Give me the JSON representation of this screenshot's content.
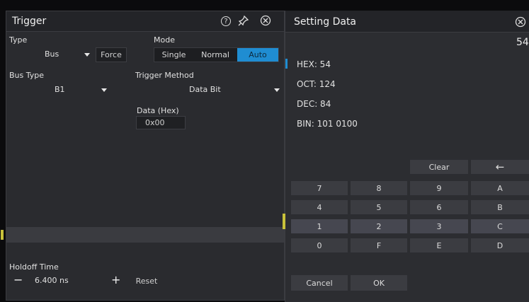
{
  "trigger": {
    "title": "Trigger",
    "type_label": "Type",
    "type_value": "Bus",
    "force_label": "Force",
    "mode_label": "Mode",
    "mode_options": [
      "Single",
      "Normal",
      "Auto"
    ],
    "mode_selected": "Auto",
    "bus_type_label": "Bus Type",
    "bus_type_value": "B1",
    "trigger_method_label": "Trigger Method",
    "trigger_method_value": "Data Bit",
    "data_label": "Data (Hex)",
    "data_value": "0x00",
    "holdoff_label": "Holdoff Time",
    "holdoff_minus": "−",
    "holdoff_value": "6.400 ns",
    "holdoff_plus": "+",
    "reset_label": "Reset",
    "help_glyph": "?",
    "icons": [
      "help-icon",
      "pin-icon",
      "close-icon"
    ]
  },
  "setting": {
    "title": "Setting Data",
    "value_display": "54",
    "hex": "HEX: 54",
    "oct": "OCT: 124",
    "dec": "DEC: 84",
    "bin": "BIN: 101 0100",
    "clear_label": "Clear",
    "backspace_glyph": "←",
    "keys": [
      [
        "7",
        "8",
        "9",
        "A"
      ],
      [
        "4",
        "5",
        "6",
        "B"
      ],
      [
        "1",
        "2",
        "3",
        "C"
      ],
      [
        "0",
        "F",
        "E",
        "D"
      ]
    ],
    "cancel_label": "Cancel",
    "ok_label": "OK"
  },
  "colors": {
    "accent": "#1f8dd2",
    "panel_bg": "#2a2b2f",
    "marker": "#c9c23a"
  }
}
